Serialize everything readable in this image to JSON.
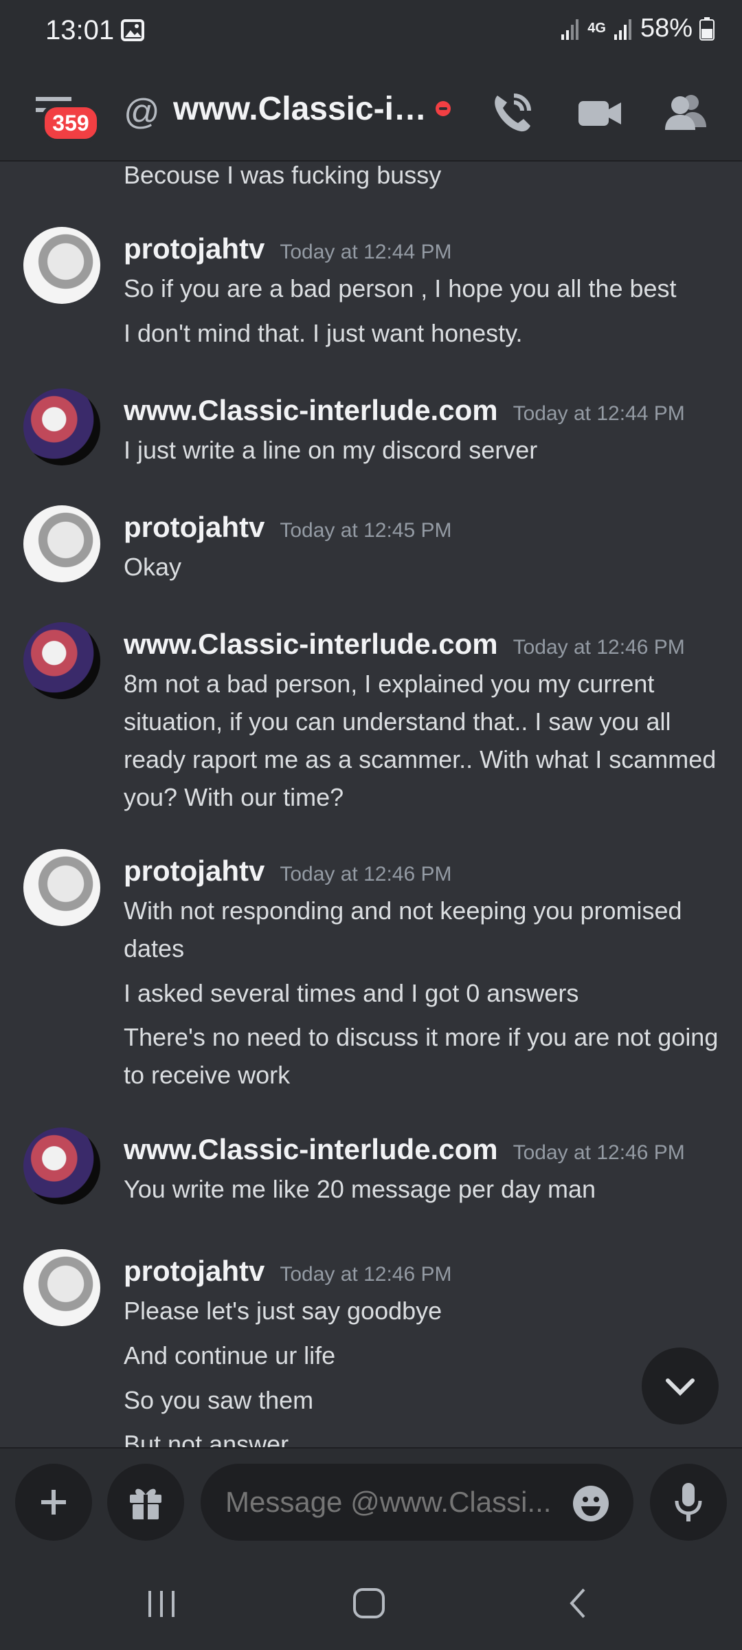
{
  "status_bar": {
    "time": "13:01",
    "network": "4G",
    "battery": "58%",
    "icons": [
      "gallery-icon",
      "signal-icon",
      "signal-icon",
      "battery-icon"
    ]
  },
  "header": {
    "unread_count": "359",
    "channel_type_icon": "@",
    "title": "www.Classic-int...",
    "status": "do-not-disturb",
    "icons": [
      "hamburger-menu-icon",
      "phone-call-icon",
      "video-camera-icon",
      "members-icon"
    ]
  },
  "messages": [
    {
      "author": "",
      "time": "",
      "lines": [
        "Becouse I was fucking bussy"
      ]
    },
    {
      "author": "protojahtv",
      "time": "Today at 12:44 PM",
      "lines": [
        "So if you are a bad person , I hope you all the best",
        "I don't mind that. I just want honesty."
      ]
    },
    {
      "author": "www.Classic-interlude.com",
      "time": "Today at 12:44 PM",
      "lines": [
        "I just write a line  on my discord server"
      ]
    },
    {
      "author": "protojahtv",
      "time": "Today at 12:45 PM",
      "lines": [
        "Okay"
      ]
    },
    {
      "author": "www.Classic-interlude.com",
      "time": "Today at 12:46 PM",
      "lines": [
        "8m not a bad person, I explained you my current situation, if you can understand that.. I saw you all ready raport me as a scammer.. With what I scammed you? With our time?"
      ]
    },
    {
      "author": "protojahtv",
      "time": "Today at 12:46 PM",
      "lines": [
        "With not responding and not keeping you promised dates",
        "I asked several times and I got 0 answers",
        "There's no need to discuss it more if you are not going to receive work"
      ]
    },
    {
      "author": "www.Classic-interlude.com",
      "time": "Today at 12:46 PM",
      "lines": [
        "You write me like 20 message per day man"
      ]
    },
    {
      "author": "protojahtv",
      "time": "Today at 12:46 PM",
      "lines": [
        "Please let's just say goodbye",
        "And continue ur life",
        "So you saw them",
        "But not answer"
      ]
    }
  ],
  "composer": {
    "placeholder": "Message @www.Classi...",
    "icons": [
      "plus-icon",
      "gift-icon",
      "emoji-icon",
      "microphone-icon"
    ]
  },
  "navigation": {
    "icons": [
      "recents-icon",
      "home-icon",
      "back-icon"
    ]
  },
  "colors": {
    "background": "#313338",
    "header": "#2b2d31",
    "input": "#1e1f22",
    "badge": "#f23f43",
    "text": "#dbdee1",
    "muted": "#949ba4"
  }
}
